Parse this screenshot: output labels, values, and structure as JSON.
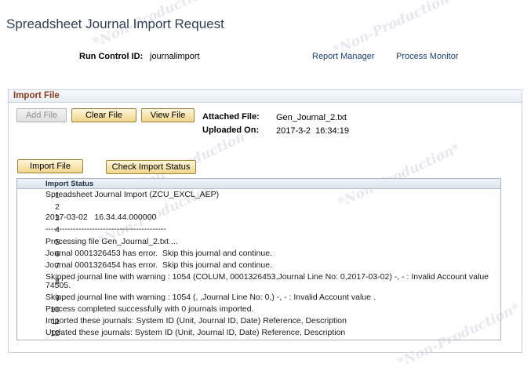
{
  "page": {
    "title": "Spreadsheet Journal Import Request",
    "run_control_label": "Run Control ID:",
    "run_control_value": "journalimport",
    "links": [
      "Report Manager",
      "Process Monitor"
    ]
  },
  "import_file": {
    "title": "Import File",
    "buttons": {
      "add_file": "Add File",
      "clear_file": "Clear File",
      "view_file": "View File",
      "import_file": "Import File",
      "check_status": "Check Import Status"
    },
    "attached_label": "Attached File:",
    "attached_value": "Gen_Journal_2.txt",
    "uploaded_label": "Uploaded On:",
    "uploaded_value": "2017-3-2  16:34:19"
  },
  "import_status": {
    "header": "Import Status",
    "rows": [
      {
        "num": "1",
        "text": "Spreadsheet Journal Import (ZCU_EXCL_AEP)"
      },
      {
        "num": "2",
        "text": ""
      },
      {
        "num": "3",
        "text": "2017-03-02   16.34.44.000000"
      },
      {
        "num": "4",
        "text": "--------------------------------------------"
      },
      {
        "num": "5",
        "text": "Processing file Gen_Journal_2.txt ..."
      },
      {
        "num": "6",
        "text": "Journal 0001326453 has error.  Skip this journal and continue."
      },
      {
        "num": "7",
        "text": "Journal 0001326454 has error.  Skip this journal and continue."
      },
      {
        "num": "8",
        "text": "Skipped journal line with warning : 1054 (COLUM, 0001326453,Journal Line No: 0,2017-03-02) -, - : Invalid Account value 74505."
      },
      {
        "num": "9",
        "text": "Skipped journal line with warning : 1054 (, ,Journal Line No: 0,) -, - : Invalid Account value ."
      },
      {
        "num": "10",
        "text": "Process completed successfully with 0 journals imported."
      },
      {
        "num": "11",
        "text": "Imported these journals: System ID (Unit, Journal ID, Date) Reference, Description"
      },
      {
        "num": "12",
        "text": "Updated these journals: System ID (Unit, Journal ID, Date) Reference, Description"
      }
    ]
  },
  "watermark_text": "*Non-Production*"
}
